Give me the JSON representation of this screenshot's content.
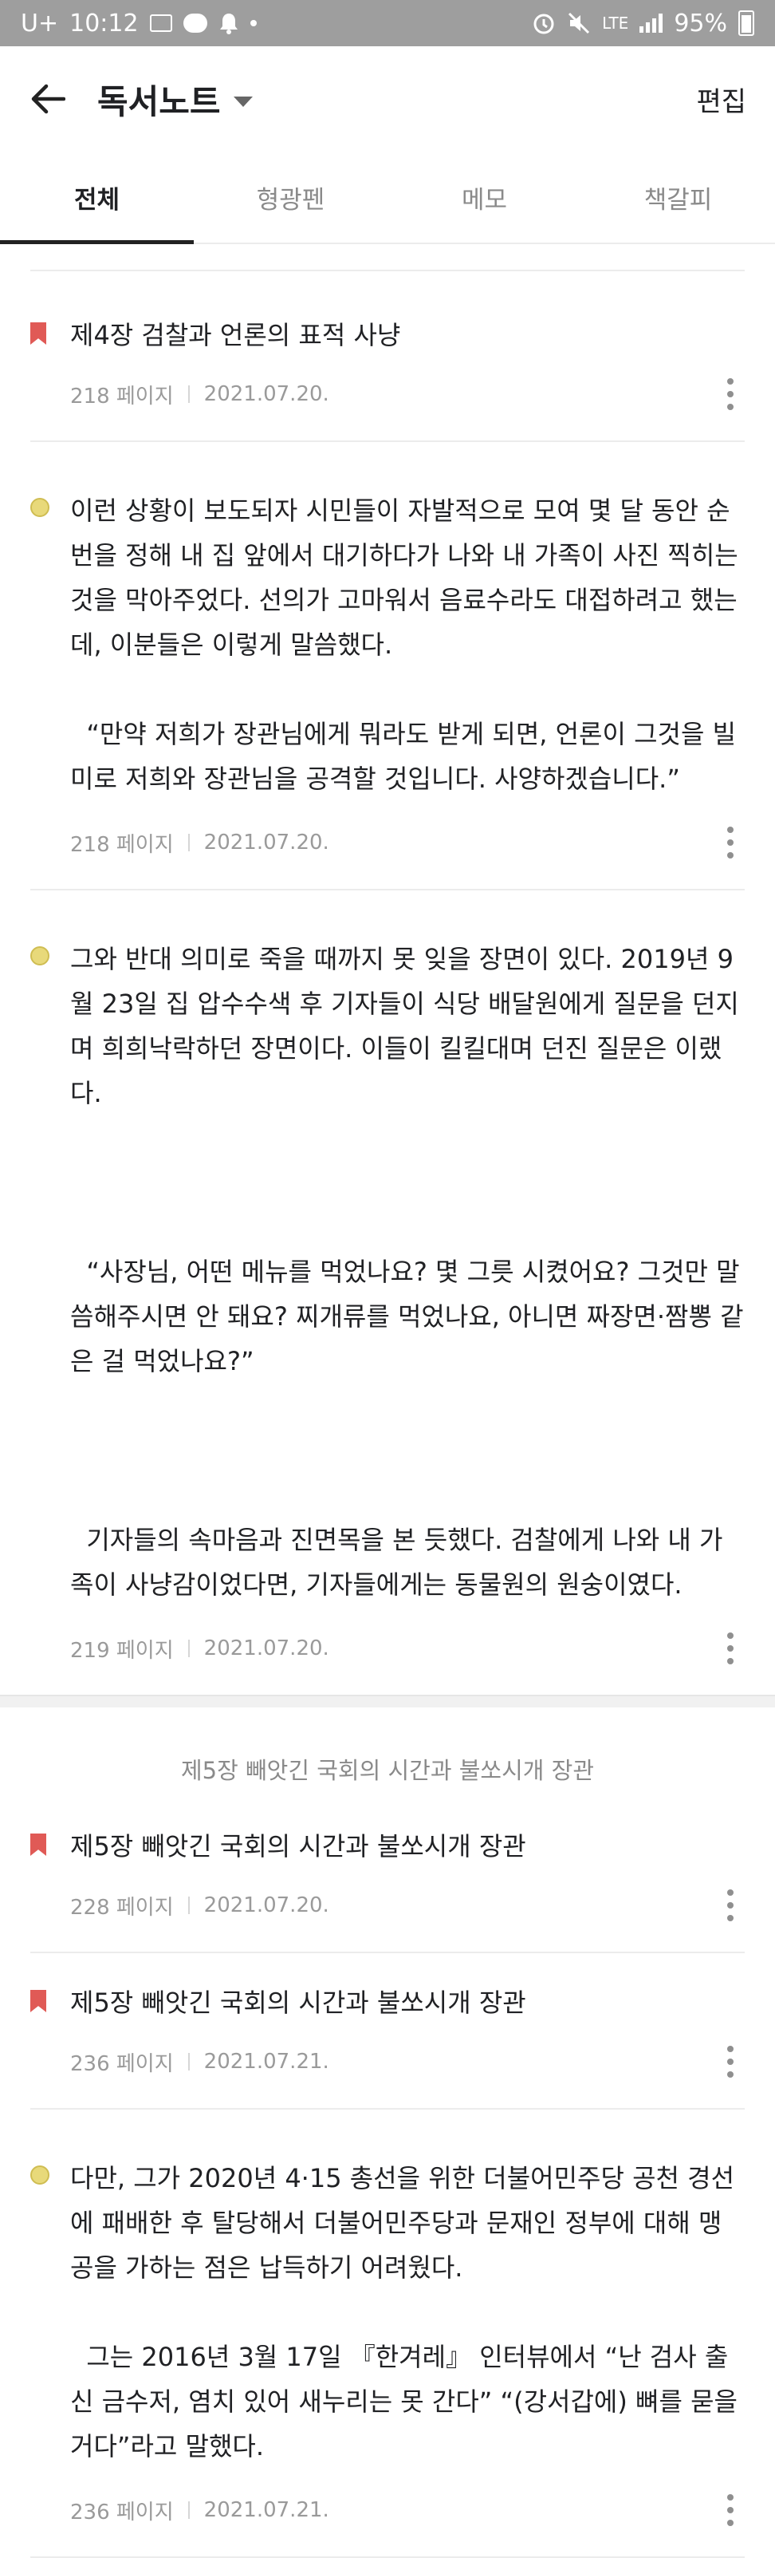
{
  "status_bar": {
    "carrier": "U+",
    "time": "10:12",
    "network": "LTE",
    "battery": "95%"
  },
  "header": {
    "title": "독서노트",
    "edit_label": "편집"
  },
  "tabs": [
    {
      "label": "전체",
      "active": true
    },
    {
      "label": "형광펜",
      "active": false
    },
    {
      "label": "메모",
      "active": false
    },
    {
      "label": "책갈피",
      "active": false
    }
  ],
  "notes": [
    {
      "kind": "bookmark",
      "text": "제4장 검찰과 언론의 표적 사냥",
      "page": "218 페이지",
      "date": "2021.07.20."
    },
    {
      "kind": "highlight",
      "text": "이런 상황이 보도되자 시민들이 자발적으로 모여 몇 달 동안 순번을 정해 내 집 앞에서 대기하다가 나와 내 가족이 사진 찍히는 것을 막아주었다. 선의가 고마워서 음료수라도 대접하려고 했는데, 이분들은 이렇게 말씀했다.\n\n  “만약 저희가 장관님에게 뭐라도 받게 되면, 언론이 그것을 빌미로 저희와 장관님을 공격할 것입니다. 사양하겠습니다.”",
      "page": "218 페이지",
      "date": "2021.07.20."
    },
    {
      "kind": "highlight",
      "text": "그와 반대 의미로 죽을 때까지 못 잊을 장면이 있다. 2019년 9월 23일 집 압수수색 후 기자들이 식당 배달원에게 질문을 던지며 희희낙락하던 장면이다. 이들이 킬킬대며 던진 질문은 이랬다.\n\n\n\n  “사장님, 어떤 메뉴를 먹었나요? 몇 그릇 시켰어요? 그것만 말씀해주시면 안 돼요? 찌개류를 먹었나요, 아니면 짜장면·짬뽕 같은 걸 먹었나요?”\n\n\n\n  기자들의 속마음과 진면목을 본 듯했다. 검찰에게 나와 내 가족이 사냥감이었다면, 기자들에게는 동물원의 원숭이였다.",
      "page": "219 페이지",
      "date": "2021.07.20."
    }
  ],
  "chapter_header": "제5장 빼앗긴 국회의 시간과 불쏘시개 장관",
  "notes2": [
    {
      "kind": "bookmark",
      "text": "제5장 빼앗긴 국회의 시간과 불쏘시개 장관",
      "page": "228 페이지",
      "date": "2021.07.20."
    },
    {
      "kind": "bookmark",
      "text": "제5장 빼앗긴 국회의 시간과 불쏘시개 장관",
      "page": "236 페이지",
      "date": "2021.07.21."
    },
    {
      "kind": "highlight",
      "text": "다만, 그가 2020년 4·15 총선을 위한 더불어민주당 공천 경선에 패배한 후 탈당해서 더불어민주당과 문재인 정부에 대해 맹공을 가하는 점은 납득하기 어려웠다.\n\n  그는 2016년 3월 17일 『한겨레』 인터뷰에서 “난 검사 출신 금수저, 염치 있어 새누리는 못 간다” “(강서갑에) 뼈를 묻을 거다”라고 말했다.",
      "page": "236 페이지",
      "date": "2021.07.21."
    }
  ],
  "icons": {
    "back": "arrow-left-icon",
    "dropdown": "caret-down-icon",
    "bookmark": "bookmark-icon",
    "highlight": "highlight-dot-icon",
    "more": "more-vertical-icon"
  },
  "colors": {
    "bookmark": "#e05a56",
    "highlight": "#e8d97a",
    "statusbar": "#9e9e9e",
    "active_tab": "#222222"
  }
}
